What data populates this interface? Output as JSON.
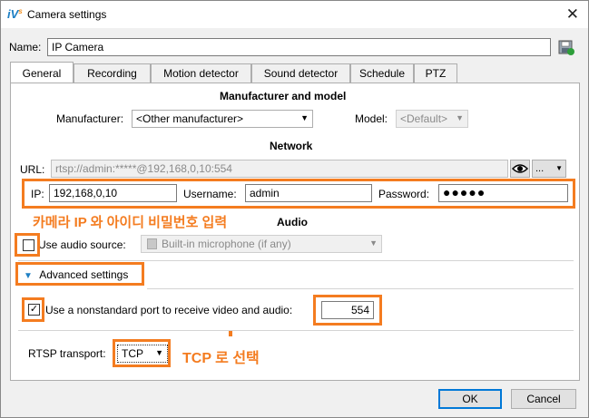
{
  "window": {
    "app_logo": "iV",
    "app_logo_suffix": "s",
    "title": "Camera settings",
    "close_glyph": "✕"
  },
  "name_field": {
    "label": "Name:",
    "value": "IP Camera"
  },
  "tabs": [
    "General",
    "Recording",
    "Motion detector",
    "Sound detector",
    "Schedule",
    "PTZ"
  ],
  "manufacturer_section": {
    "title": "Manufacturer and model",
    "manufacturer_label": "Manufacturer:",
    "manufacturer_value": "<Other manufacturer>",
    "model_label": "Model:",
    "model_value": "<Default>"
  },
  "network_section": {
    "title": "Network",
    "url_label": "URL:",
    "url_value": "rtsp://admin:*****@192,168,0,10:554",
    "more_button": "...",
    "ip_label": "IP:",
    "ip_value": "192,168,0,10",
    "username_label": "Username:",
    "username_value": "admin",
    "password_label": "Password:",
    "password_value": "●●●●●"
  },
  "audio_section": {
    "title": "Audio",
    "use_audio_label": "Use audio source:",
    "use_audio_checked": false,
    "audio_source_value": "Built-in microphone (if any)"
  },
  "advanced": {
    "toggle_label": "Advanced settings",
    "nonstandard_port_label": "Use a nonstandard port to receive video and audio:",
    "nonstandard_port_checked": true,
    "check_glyph": "✓",
    "port_value": "554",
    "rtsp_label": "RTSP transport:",
    "rtsp_value": "TCP"
  },
  "annotations": {
    "ip_note": "카메라 IP 와 아이디 비밀번호 입력",
    "tcp_note": "TCP 로 선택"
  },
  "buttons": {
    "ok": "OK",
    "cancel": "Cancel"
  },
  "colors": {
    "highlight": "#f47c20",
    "accent": "#0078d7"
  }
}
